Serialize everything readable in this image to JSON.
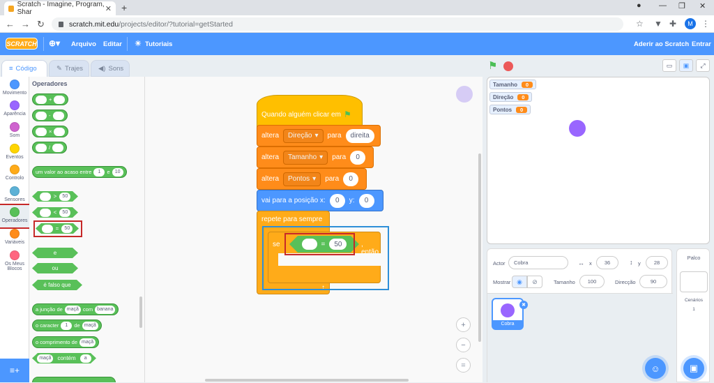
{
  "browser": {
    "tab_title": "Scratch - Imagine, Program, Shar",
    "url_host": "scratch.mit.edu",
    "url_path": "/projects/editor/?tutorial=getStarted",
    "profile_initial": "M"
  },
  "menubar": {
    "logo": "SCRATCH",
    "file": "Arquivo",
    "edit": "Editar",
    "tutorials": "Tutoriais",
    "join": "Aderir ao Scratch",
    "signin": "Entrar"
  },
  "editor_tabs": {
    "code": "Código",
    "costumes": "Trajes",
    "sounds": "Sons"
  },
  "categories": [
    {
      "label": "Movimento",
      "color": "#4c97ff"
    },
    {
      "label": "Aparência",
      "color": "#9966ff"
    },
    {
      "label": "Som",
      "color": "#cf63cf"
    },
    {
      "label": "Eventos",
      "color": "#ffd500"
    },
    {
      "label": "Controlo",
      "color": "#ffab19"
    },
    {
      "label": "Sensores",
      "color": "#5cb1d6"
    },
    {
      "label": "Operadores",
      "color": "#59c059"
    },
    {
      "label": "Variáveis",
      "color": "#ff8c1a"
    },
    {
      "label": "Os Meus Blocos",
      "color": "#ff6680"
    }
  ],
  "palette": {
    "title": "Operadores",
    "add": "+",
    "sub": "-",
    "mul": "×",
    "div": "/",
    "random_a": "um valor ao acaso entre",
    "random_b": "e",
    "random_min": "1",
    "random_max": "10",
    "gt": ">",
    "lt": "<",
    "eq": "=",
    "cmp_value": "50",
    "and": "e",
    "or": "ou",
    "not": "é falso que",
    "join_a": "a junção de",
    "join_b": "com",
    "join_v1": "maçã",
    "join_v2": "banana",
    "letter_a": "o caracter",
    "letter_b": "de",
    "letter_n": "1",
    "letter_word": "maçã",
    "length_a": "o comprimento de",
    "length_word": "maçã",
    "contains_word": "maçã",
    "contains_b": "contém",
    "contains_letter": "a"
  },
  "script": {
    "hat": "Quando alguém clicar em",
    "set_word": "altera",
    "to_word": "para",
    "var1": "Direção",
    "val1": "direita",
    "var2": "Tamanho",
    "val2": "0",
    "var3": "Pontos",
    "val3": "0",
    "goto": "vai para a posição x:",
    "goto_x": "0",
    "goto_y_label": "y:",
    "goto_y": "0",
    "forever": "repete para sempre",
    "if_label": "se",
    "then_label": ", então",
    "cond_op": "=",
    "cond_value": "50"
  },
  "zoom": {
    "in": "+",
    "out": "−",
    "reset": "="
  },
  "stage": {
    "monitors": [
      {
        "name": "Tamanho",
        "value": "0"
      },
      {
        "name": "Direção",
        "value": "0"
      },
      {
        "name": "Pontos",
        "value": "0"
      }
    ]
  },
  "sprite_info": {
    "actor_label": "Actor",
    "actor_name": "Cobra",
    "x_label": "x",
    "x": "36",
    "y_label": "y",
    "y": "28",
    "show_label": "Mostrar",
    "size_label": "Tamanho",
    "size": "100",
    "direction_label": "Direcção",
    "direction": "90"
  },
  "sprites": [
    {
      "name": "Cobra"
    }
  ],
  "backdrop": {
    "title": "Palco",
    "label": "Cenários",
    "count": "1"
  }
}
